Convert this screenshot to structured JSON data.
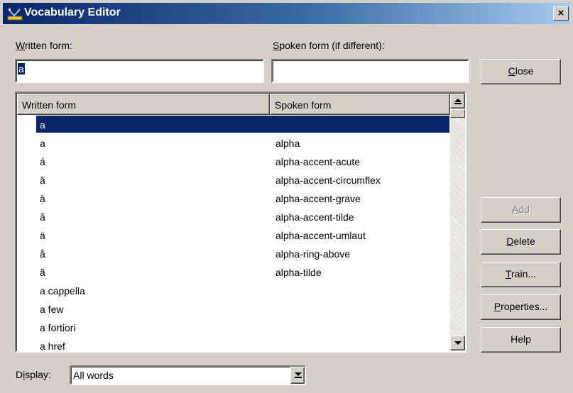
{
  "window": {
    "title": "Vocabulary Editor",
    "close_glyph": "×",
    "icon": "vocabulary-app-icon"
  },
  "written_form": {
    "label_accel": "W",
    "label_rest": "ritten form:",
    "value": "a"
  },
  "spoken_form": {
    "label_accel": "S",
    "label_rest": "poken form (if different):",
    "value": ""
  },
  "list": {
    "columns": [
      "Written form",
      "Spoken form"
    ],
    "selected_index": 0,
    "rows": [
      {
        "written": "a",
        "spoken": ""
      },
      {
        "written": "a",
        "spoken": "alpha"
      },
      {
        "written": "á",
        "spoken": "alpha-accent-acute"
      },
      {
        "written": "â",
        "spoken": "alpha-accent-circumflex"
      },
      {
        "written": "à",
        "spoken": "alpha-accent-grave"
      },
      {
        "written": "ã",
        "spoken": "alpha-accent-tilde"
      },
      {
        "written": "ä",
        "spoken": "alpha-accent-umlaut"
      },
      {
        "written": "å",
        "spoken": "alpha-ring-above"
      },
      {
        "written": "ã",
        "spoken": "alpha-tilde"
      },
      {
        "written": "a cappella",
        "spoken": ""
      },
      {
        "written": "a few",
        "spoken": ""
      },
      {
        "written": "a fortiori",
        "spoken": ""
      },
      {
        "written": "a href",
        "spoken": ""
      }
    ]
  },
  "buttons": {
    "close": {
      "accel": "C",
      "rest": "lose"
    },
    "add": {
      "accel": "A",
      "rest": "dd",
      "disabled": true
    },
    "delete": {
      "accel": "D",
      "rest": "elete"
    },
    "train": {
      "accel": "T",
      "rest": "rain..."
    },
    "properties": {
      "accel": "P",
      "rest": "roperties..."
    },
    "help": {
      "label": "Help"
    }
  },
  "display": {
    "label_pre": "D",
    "label_accel": "i",
    "label_post": "splay:",
    "selected": "All words"
  },
  "colors": {
    "title_bar": "#0a246a",
    "selection": "#0a246a",
    "face": "#d4d0c8"
  }
}
